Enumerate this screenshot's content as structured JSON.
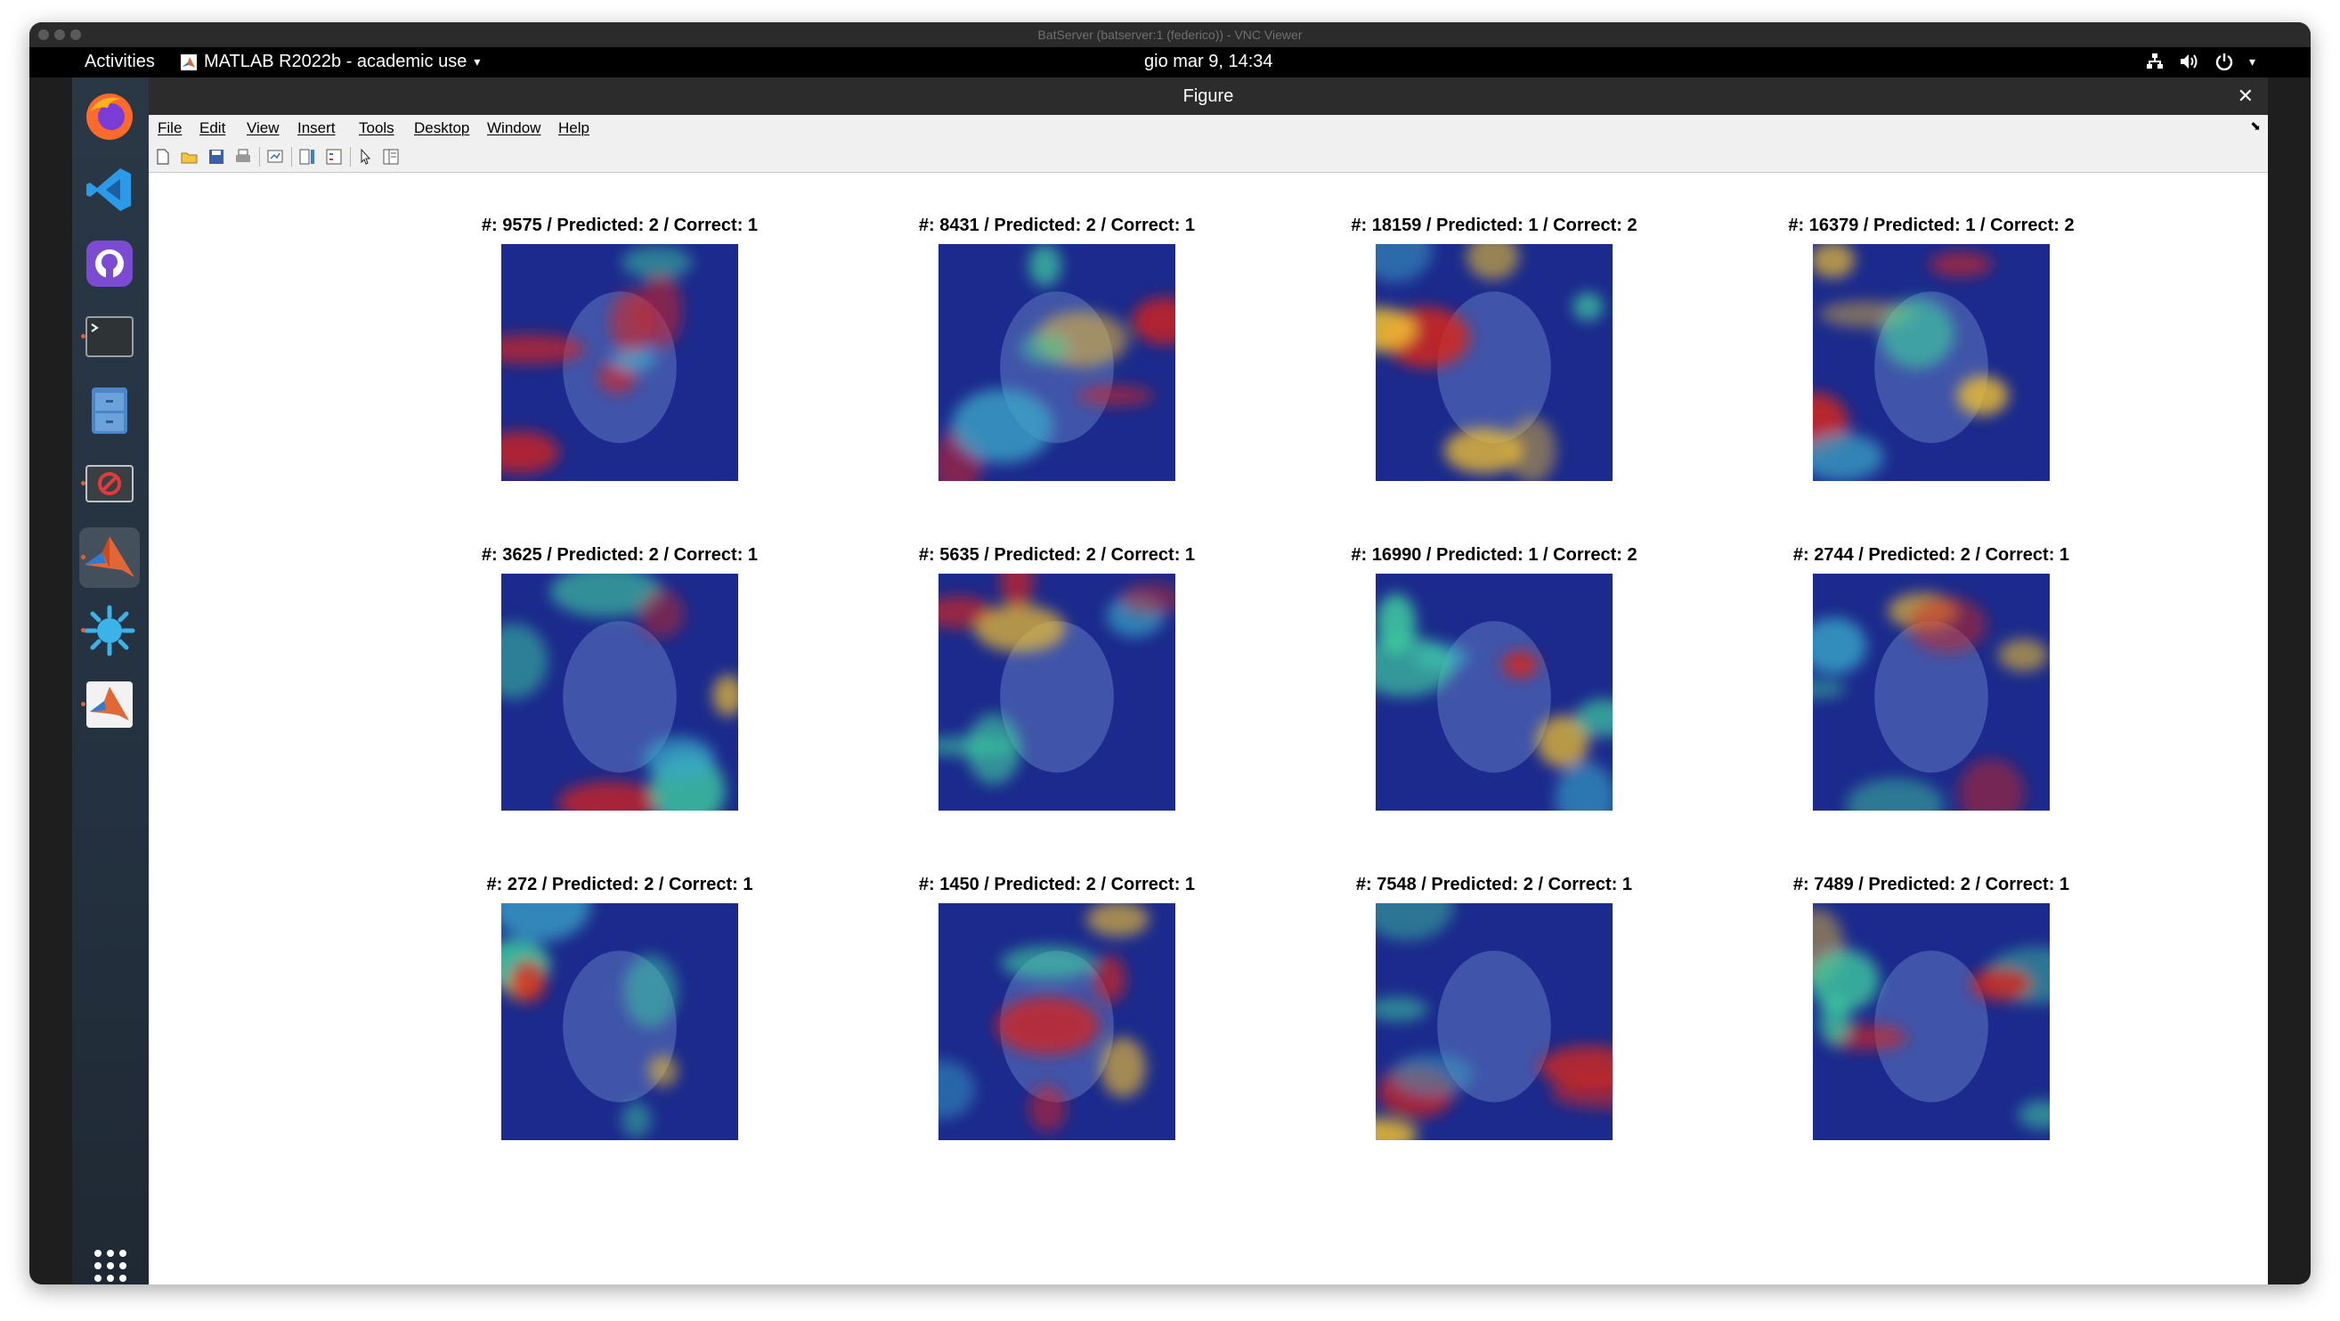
{
  "vnc_window": {
    "title": "BatServer (batserver:1 (federico)) - VNC Viewer"
  },
  "topbar": {
    "activities": "Activities",
    "app_menu": "MATLAB R2022b - academic use",
    "clock": "gio mar  9, 14:34"
  },
  "dock": {
    "items": [
      {
        "name": "firefox-icon"
      },
      {
        "name": "vscode-icon"
      },
      {
        "name": "github-desktop-icon"
      },
      {
        "name": "terminal-icon"
      },
      {
        "name": "file-cabinet-icon"
      },
      {
        "name": "blocked-app-icon"
      },
      {
        "name": "matlab-icon"
      },
      {
        "name": "splash-app-icon"
      },
      {
        "name": "matlab-alt-icon"
      },
      {
        "name": "show-apps-grid-icon"
      }
    ]
  },
  "figure": {
    "title": "Figure",
    "menus": [
      "File",
      "Edit",
      "View",
      "Insert",
      "Tools",
      "Desktop",
      "Window",
      "Help"
    ],
    "toolbar": [
      "new-figure-icon",
      "open-file-icon",
      "save-icon",
      "print-icon",
      "link-plot-icon",
      "colorbar-icon",
      "legend-icon",
      "pointer-icon",
      "property-editor-icon"
    ],
    "tiles": [
      {
        "title": "#: 9575 / Predicted: 2 / Correct: 1"
      },
      {
        "title": "#: 8431 / Predicted: 2 / Correct: 1"
      },
      {
        "title": "#: 18159 / Predicted: 1 / Correct: 2"
      },
      {
        "title": "#: 16379 / Predicted: 1 / Correct: 2"
      },
      {
        "title": "#: 3625 / Predicted: 2 / Correct: 1"
      },
      {
        "title": "#: 5635 / Predicted: 2 / Correct: 1"
      },
      {
        "title": "#: 16990 / Predicted: 1 / Correct: 2"
      },
      {
        "title": "#: 2744 / Predicted: 2 / Correct: 1"
      },
      {
        "title": "#: 272 / Predicted: 2 / Correct: 1"
      },
      {
        "title": "#: 1450 / Predicted: 2 / Correct: 1"
      },
      {
        "title": "#: 7548 / Predicted: 2 / Correct: 1"
      },
      {
        "title": "#: 7489 / Predicted: 2 / Correct: 1"
      }
    ]
  },
  "colors": {
    "heatmap_low": "#1b2a8c",
    "heatmap_mid": "#3aa6c8",
    "heatmap_warm": "#f2c230",
    "heatmap_hot": "#d8241c",
    "window_chrome": "#2c2c2c",
    "menubar_bg": "#f0f0f0"
  }
}
